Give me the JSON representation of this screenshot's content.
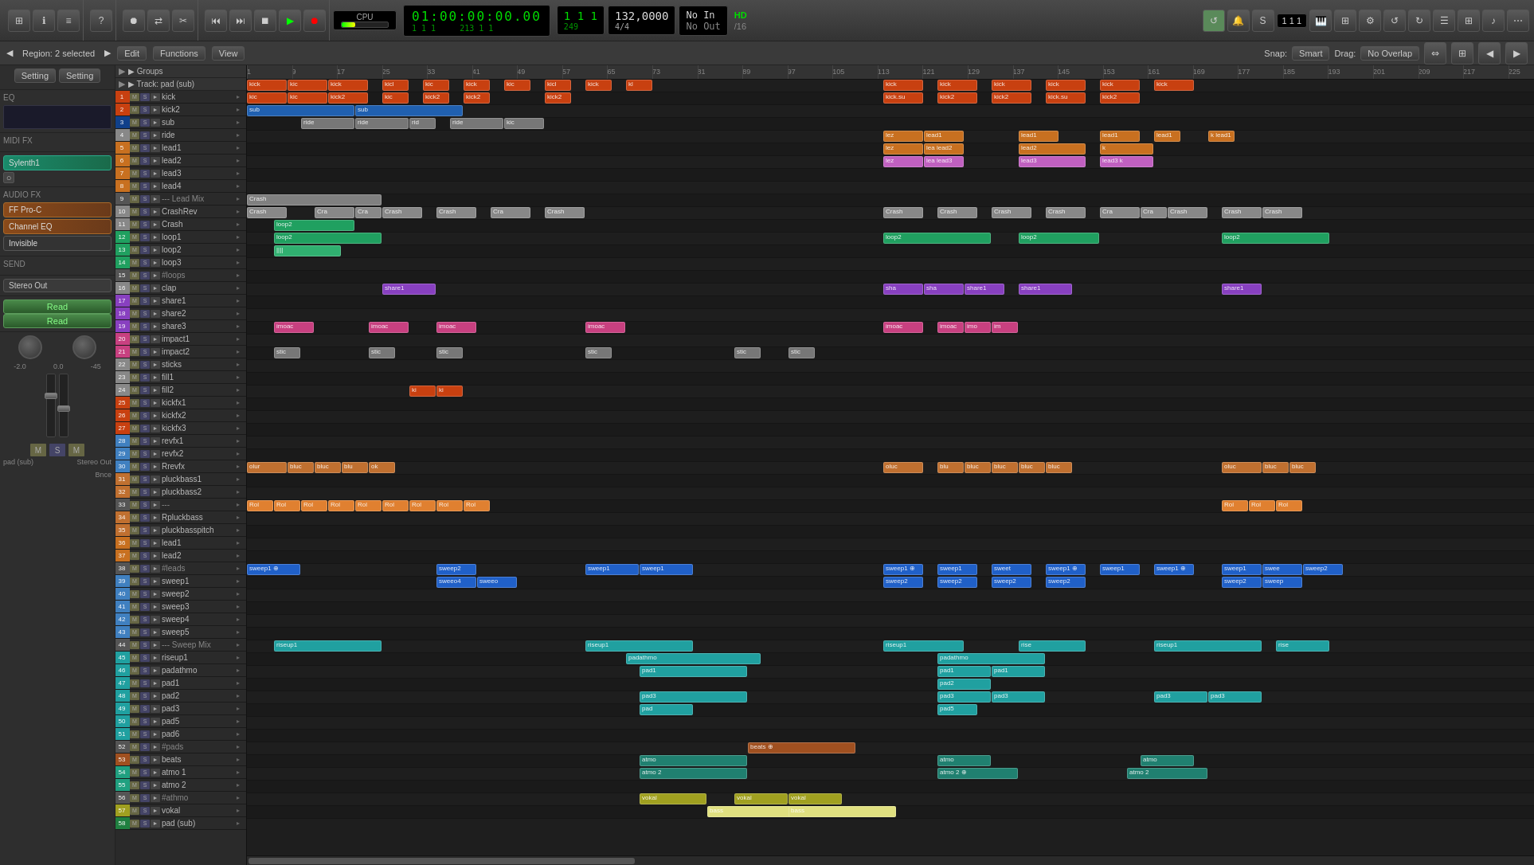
{
  "toolbar": {
    "transport": {
      "time_display": "01:00:00:00.00",
      "bars_beats": "1  1  1",
      "sub_time": "1  1  1",
      "sub_bars": "213  1  1",
      "position": "249",
      "tempo": "132,0000",
      "time_sig": "4/4",
      "no_in": "No In",
      "no_out": "No Out",
      "hd": "HD",
      "division": "/16"
    },
    "cpu_label": "CPU",
    "buttons": {
      "rewind": "⏮",
      "fast_forward": "⏭",
      "stop": "⏹",
      "play": "▶",
      "record": "⏺"
    }
  },
  "region_header": {
    "region_label": "Region: 2 selected",
    "edit_btn": "Edit",
    "functions_btn": "Functions",
    "view_btn": "View",
    "snap_label": "Snap:",
    "snap_value": "Smart",
    "drag_label": "Drag:",
    "drag_value": "No Overlap"
  },
  "left_panel": {
    "setting_label": "Setting",
    "eq_label": "EQ",
    "midi_fx_label": "MIDI FX",
    "plugin1": "Sylenth1",
    "plugin2": "FF Pro-C",
    "plugin3": "Channel EQ",
    "plugin4": "Invisible",
    "audio_fx_label": "Audio FX",
    "send_label": "Send",
    "stereo_out": "Stereo Out",
    "read_label": "Read",
    "volume": "-2.0",
    "pan": "0.0",
    "vu": "-45",
    "pad_sub": "pad (sub)",
    "stereo_out2": "Stereo Out",
    "bnce": "Bnce"
  },
  "ruler": {
    "marks": [
      "1",
      "9",
      "17",
      "25",
      "33",
      "41",
      "49",
      "57",
      "65",
      "73",
      "81",
      "89",
      "97",
      "105",
      "113",
      "121",
      "129",
      "137",
      "145",
      "153",
      "161",
      "169",
      "177",
      "185",
      "193",
      "201",
      "209",
      "217",
      "225"
    ]
  },
  "tracks": [
    {
      "num": "1",
      "name": "kick",
      "color": "#c84010",
      "controls": [
        "M",
        "S",
        "►"
      ]
    },
    {
      "num": "2",
      "name": "kick2",
      "color": "#c84010",
      "controls": [
        "M",
        "S",
        "►"
      ]
    },
    {
      "num": "3",
      "name": "sub",
      "color": "#10408a",
      "controls": [
        "M",
        "S",
        "►"
      ]
    },
    {
      "num": "4",
      "name": "ride",
      "color": "#888",
      "controls": [
        "M",
        "S",
        "►"
      ]
    },
    {
      "num": "5",
      "name": "lead1",
      "color": "#c87020",
      "controls": [
        "M",
        "S",
        "►"
      ]
    },
    {
      "num": "6",
      "name": "lead2",
      "color": "#c87020",
      "controls": [
        "M",
        "S",
        "►"
      ]
    },
    {
      "num": "7",
      "name": "lead3",
      "color": "#c87020",
      "controls": [
        "M",
        "S",
        "►"
      ]
    },
    {
      "num": "8",
      "name": "lead4",
      "color": "#c87020",
      "controls": [
        "M",
        "S",
        "►"
      ]
    },
    {
      "num": "9",
      "name": "--- Lead Mix",
      "color": "#555",
      "controls": [
        "M",
        "S",
        "►"
      ]
    },
    {
      "num": "10",
      "name": "CrashRev",
      "color": "#888",
      "controls": [
        "M",
        "S",
        "►"
      ]
    },
    {
      "num": "11",
      "name": "Crash",
      "color": "#888",
      "controls": [
        "M",
        "S",
        "►"
      ]
    },
    {
      "num": "12",
      "name": "loop1",
      "color": "#20a060",
      "controls": [
        "M",
        "S",
        "►"
      ]
    },
    {
      "num": "13",
      "name": "loop2",
      "color": "#20a060",
      "controls": [
        "M",
        "S",
        "►"
      ]
    },
    {
      "num": "14",
      "name": "loop3",
      "color": "#20a060",
      "controls": [
        "M",
        "S",
        "►"
      ]
    },
    {
      "num": "15",
      "name": "#loops",
      "color": "#555",
      "controls": [
        "M",
        "S",
        "►"
      ]
    },
    {
      "num": "16",
      "name": "clap",
      "color": "#888",
      "controls": [
        "M",
        "S",
        "►"
      ]
    },
    {
      "num": "17",
      "name": "share1",
      "color": "#8840c0",
      "controls": [
        "M",
        "S",
        "►"
      ]
    },
    {
      "num": "18",
      "name": "share2",
      "color": "#8840c0",
      "controls": [
        "M",
        "S",
        "►"
      ]
    },
    {
      "num": "19",
      "name": "share3",
      "color": "#8840c0",
      "controls": [
        "M",
        "S",
        "►"
      ]
    },
    {
      "num": "20",
      "name": "impact1",
      "color": "#c84080",
      "controls": [
        "M",
        "S",
        "►"
      ]
    },
    {
      "num": "21",
      "name": "impact2",
      "color": "#c84080",
      "controls": [
        "M",
        "S",
        "►"
      ]
    },
    {
      "num": "22",
      "name": "sticks",
      "color": "#888",
      "controls": [
        "M",
        "S",
        "►"
      ]
    },
    {
      "num": "23",
      "name": "fill1",
      "color": "#888",
      "controls": [
        "M",
        "S",
        "►"
      ]
    },
    {
      "num": "24",
      "name": "fill2",
      "color": "#888",
      "controls": [
        "M",
        "S",
        "►"
      ]
    },
    {
      "num": "25",
      "name": "kickfx1",
      "color": "#c84010",
      "controls": [
        "M",
        "S",
        "►"
      ]
    },
    {
      "num": "26",
      "name": "kickfx2",
      "color": "#c84010",
      "controls": [
        "M",
        "S",
        "►"
      ]
    },
    {
      "num": "27",
      "name": "kickfx3",
      "color": "#c84010",
      "controls": [
        "M",
        "S",
        "►"
      ]
    },
    {
      "num": "28",
      "name": "revfx1",
      "color": "#4080c0",
      "controls": [
        "M",
        "S",
        "►"
      ]
    },
    {
      "num": "29",
      "name": "revfx2",
      "color": "#4080c0",
      "controls": [
        "M",
        "S",
        "►"
      ]
    },
    {
      "num": "30",
      "name": "Rrevfx",
      "color": "#4080c0",
      "controls": [
        "M",
        "S",
        "►"
      ]
    },
    {
      "num": "31",
      "name": "pluckbass1",
      "color": "#c07030",
      "controls": [
        "M",
        "S",
        "►"
      ]
    },
    {
      "num": "32",
      "name": "pluckbass2",
      "color": "#c07030",
      "controls": [
        "M",
        "S",
        "►"
      ]
    },
    {
      "num": "33",
      "name": "---",
      "color": "#555",
      "controls": [
        "M",
        "S",
        "►"
      ]
    },
    {
      "num": "34",
      "name": "Rpluckbass",
      "color": "#c07030",
      "controls": [
        "M",
        "S",
        "►"
      ]
    },
    {
      "num": "35",
      "name": "pluckbasspitch",
      "color": "#c07030",
      "controls": [
        "M",
        "S",
        "►"
      ]
    },
    {
      "num": "36",
      "name": "lead1",
      "color": "#c87020",
      "controls": [
        "M",
        "S",
        "►"
      ]
    },
    {
      "num": "37",
      "name": "lead2",
      "color": "#c87020",
      "controls": [
        "M",
        "S",
        "►"
      ]
    },
    {
      "num": "38",
      "name": "#leads",
      "color": "#555",
      "controls": [
        "M",
        "S",
        "►"
      ]
    },
    {
      "num": "39",
      "name": "sweep1",
      "color": "#4080c0",
      "controls": [
        "M",
        "S",
        "►"
      ]
    },
    {
      "num": "40",
      "name": "sweep2",
      "color": "#4080c0",
      "controls": [
        "M",
        "S",
        "►"
      ]
    },
    {
      "num": "41",
      "name": "sweep3",
      "color": "#4080c0",
      "controls": [
        "M",
        "S",
        "►"
      ]
    },
    {
      "num": "42",
      "name": "sweep4",
      "color": "#4080c0",
      "controls": [
        "M",
        "S",
        "►"
      ]
    },
    {
      "num": "43",
      "name": "sweep5",
      "color": "#4080c0",
      "controls": [
        "M",
        "S",
        "►"
      ]
    },
    {
      "num": "44",
      "name": "--- Sweep Mix",
      "color": "#555",
      "controls": [
        "M",
        "S",
        "►"
      ]
    },
    {
      "num": "45",
      "name": "riseup1",
      "color": "#20a0a0",
      "controls": [
        "M",
        "S",
        "►"
      ]
    },
    {
      "num": "46",
      "name": "padathmo",
      "color": "#20a0a0",
      "controls": [
        "M",
        "S",
        "►"
      ]
    },
    {
      "num": "47",
      "name": "pad1",
      "color": "#20a0a0",
      "controls": [
        "M",
        "S",
        "►"
      ]
    },
    {
      "num": "48",
      "name": "pad2",
      "color": "#20a0a0",
      "controls": [
        "M",
        "S",
        "►"
      ]
    },
    {
      "num": "49",
      "name": "pad3",
      "color": "#20a0a0",
      "controls": [
        "M",
        "S",
        "►"
      ]
    },
    {
      "num": "50",
      "name": "pad5",
      "color": "#20a0a0",
      "controls": [
        "M",
        "S",
        "►"
      ]
    },
    {
      "num": "51",
      "name": "pad6",
      "color": "#20a0a0",
      "controls": [
        "M",
        "S",
        "►"
      ]
    },
    {
      "num": "52",
      "name": "#pads",
      "color": "#555",
      "controls": [
        "M",
        "S",
        "►"
      ]
    },
    {
      "num": "53",
      "name": "beats",
      "color": "#a05020",
      "controls": [
        "M",
        "S",
        "►"
      ]
    },
    {
      "num": "54",
      "name": "atmo 1",
      "color": "#20a080",
      "controls": [
        "M",
        "S",
        "►"
      ]
    },
    {
      "num": "55",
      "name": "atmo 2",
      "color": "#20a080",
      "controls": [
        "M",
        "S",
        "►"
      ]
    },
    {
      "num": "56",
      "name": "#athmo",
      "color": "#555",
      "controls": [
        "M",
        "S",
        "►"
      ]
    },
    {
      "num": "57",
      "name": "vokal",
      "color": "#a0a020",
      "controls": [
        "M",
        "S",
        "►"
      ]
    },
    {
      "num": "58",
      "name": "pad (sub)",
      "color": "#208040",
      "controls": [
        "M",
        "S",
        "►"
      ]
    }
  ],
  "groups": {
    "region_selected": "Region: 2 selected",
    "groups_label": "▶ Groups",
    "track_label": "▶ Track:  pad (sub)"
  },
  "bottom": {
    "m_btn": "M",
    "s_btn": "S",
    "m_btn2": "M",
    "pad_sub": "pad (sub)",
    "stereo_out": "Stereo Out",
    "bnce": "Bnce",
    "read": "Read"
  }
}
